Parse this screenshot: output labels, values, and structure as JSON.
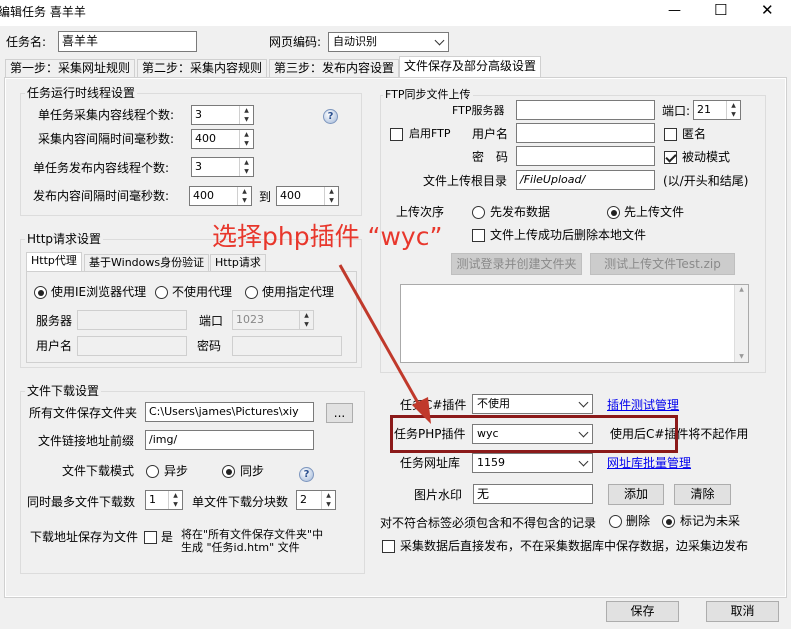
{
  "window": {
    "title": "编辑任务 喜羊羊",
    "minimize_glyph": "—",
    "maximize_glyph": "☐",
    "close_glyph": "✕"
  },
  "task": {
    "name_label": "任务名:",
    "name_value": "喜羊羊",
    "encoding_label": "网页编码:",
    "encoding_value": "自动识别"
  },
  "tabs": [
    "第一步：采集网址规则",
    "第二步：采集内容规则",
    "第三步：发布内容设置",
    "文件保存及部分高级设置"
  ],
  "threads": {
    "title": "任务运行时线程设置",
    "single_collect_label": "单任务采集内容线程个数:",
    "single_collect_value": "3",
    "collect_interval_label": "采集内容间隔时间毫秒数:",
    "collect_interval_value": "400",
    "single_publish_label": "单任务发布内容线程个数:",
    "single_publish_value": "3",
    "publish_interval_label": "发布内容间隔时间毫秒数:",
    "publish_interval_from": "400",
    "to_label": "到",
    "publish_interval_to": "400"
  },
  "http": {
    "title": "Http请求设置",
    "tabs": [
      "Http代理",
      "基于Windows身份验证",
      "Http请求"
    ],
    "radio_ie": "使用IE浏览器代理",
    "radio_none": "不使用代理",
    "radio_custom": "使用指定代理",
    "server_label": "服务器",
    "port_label": "端口",
    "port_value": "1023",
    "user_label": "用户名",
    "password_label": "密码"
  },
  "download": {
    "title": "文件下载设置",
    "save_folder_label": "所有文件保存文件夹",
    "save_folder_value": "C:\\Users\\james\\Pictures\\xiy",
    "browse_label": "...",
    "prefix_label": "文件链接地址前缀",
    "prefix_value": "/img/",
    "mode_label": "文件下载模式",
    "mode_async": "异步",
    "mode_sync": "同步",
    "max_files_label": "同时最多文件下载数",
    "max_files_value": "1",
    "chunks_label": "单文件下载分块数",
    "chunks_value": "2",
    "save_as_label": "下载地址保存为文件",
    "save_as_check": "是",
    "save_as_note_1": "将在\"所有文件保存文件夹\"中",
    "save_as_note_2": "生成 \"任务id.htm\" 文件"
  },
  "ftp": {
    "title": "FTP同步文件上传",
    "enable_label": "启用FTP",
    "server_label": "FTP服务器",
    "port_label": "端口:",
    "port_value": "21",
    "user_label": "用户名",
    "anon_label": "匿名",
    "password_label": "密　码",
    "passive_label": "被动模式",
    "root_label": "文件上传根目录",
    "root_value": "/FileUpload/",
    "root_hint": "(以/开头和结尾)",
    "order_label": "上传次序",
    "order_publish_first": "先发布数据",
    "order_upload_first": "先上传文件",
    "delete_local_label": "文件上传成功后删除本地文件",
    "test_login_button": "测试登录并创建文件夹",
    "test_upload_button": "测试上传文件Test.zip"
  },
  "plugins": {
    "cs_label": "任务C#插件",
    "cs_value": "不使用",
    "cs_link": "插件测试管理",
    "php_label": "任务PHP插件",
    "php_value": "wyc",
    "php_note": "使用后C#插件将不起作用",
    "url_db_label": "任务网址库",
    "url_db_value": "1159",
    "url_db_link": "网址库批量管理",
    "watermark_label": "图片水印",
    "watermark_value": "无",
    "add_button": "添加",
    "clear_button": "清除",
    "mismatch_label": "对不符合标签必须包含和不得包含的记录",
    "mismatch_delete": "删除",
    "mismatch_mark": "标记为未采",
    "direct_publish_label": "采集数据后直接发布，不在采集数据库中保存数据，边采集边发布"
  },
  "annotation": {
    "text": "选择php插件 “wyc”",
    "color": "#e8372c",
    "box_color": "#8b1a1a",
    "arrow_color": "#c0392b"
  },
  "footer": {
    "save_button": "保存",
    "cancel_button": "取消"
  }
}
